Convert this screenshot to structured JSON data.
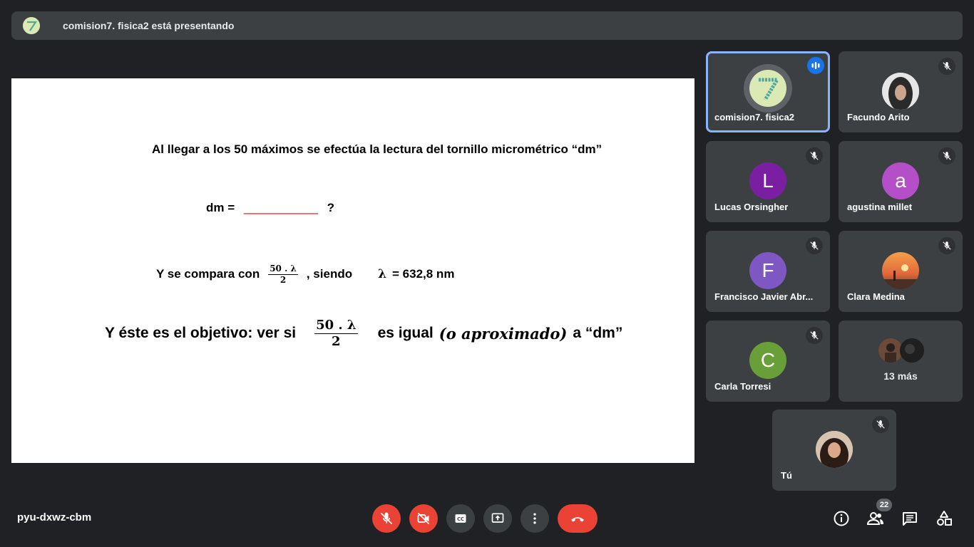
{
  "banner": {
    "presenting_text": "comision7. fisica2 está presentando"
  },
  "slide": {
    "line1": "Al llegar a los 50 máximos  se efectúa la lectura del tornillo micrométrico  “dm”",
    "line2_label": "dm  =",
    "line2_blank": "___________",
    "line2_q": "?",
    "line3_prefix": "Y se compara con",
    "frac_num": "50 . λ",
    "frac_den": "2",
    "line3_mid": ",  siendo",
    "line3_lambda": "λ",
    "line3_value": "=  632,8 nm",
    "line4_prefix": "Y éste es el objetivo:  ver si",
    "line4_mid": "es igual",
    "line4_paren": "(o aproximado)",
    "line4_suffix": "a  “dm”"
  },
  "participants": [
    {
      "name": "comision7. fisica2",
      "state": "speaking"
    },
    {
      "name": "Facundo Arito",
      "state": "muted"
    },
    {
      "name": "Lucas Orsingher",
      "initial": "L",
      "color": "#7b1fa2",
      "state": "muted"
    },
    {
      "name": "agustina millet",
      "initial": "a",
      "color": "#b44fc8",
      "state": "muted"
    },
    {
      "name": "Francisco Javier Abr...",
      "initial": "F",
      "color": "#7e57c2",
      "state": "muted"
    },
    {
      "name": "Clara Medina",
      "state": "muted"
    },
    {
      "name": "Carla Torresi",
      "initial": "C",
      "color": "#689f38",
      "state": "muted"
    },
    {
      "more_label": "13 más"
    },
    {
      "name": "Tú",
      "state": "muted"
    }
  ],
  "bottom": {
    "meeting_code": "pyu-dxwz-cbm",
    "people_count": "22"
  },
  "colors": {
    "accent": "#8ab4f8",
    "danger": "#ea4335",
    "tile": "#3c4043",
    "background": "#202124"
  },
  "icons": [
    "mic-off-icon",
    "camera-off-icon",
    "captions-icon",
    "present-icon",
    "more-vert-icon",
    "hang-up-icon",
    "info-icon",
    "people-icon",
    "chat-icon",
    "activities-icon"
  ]
}
